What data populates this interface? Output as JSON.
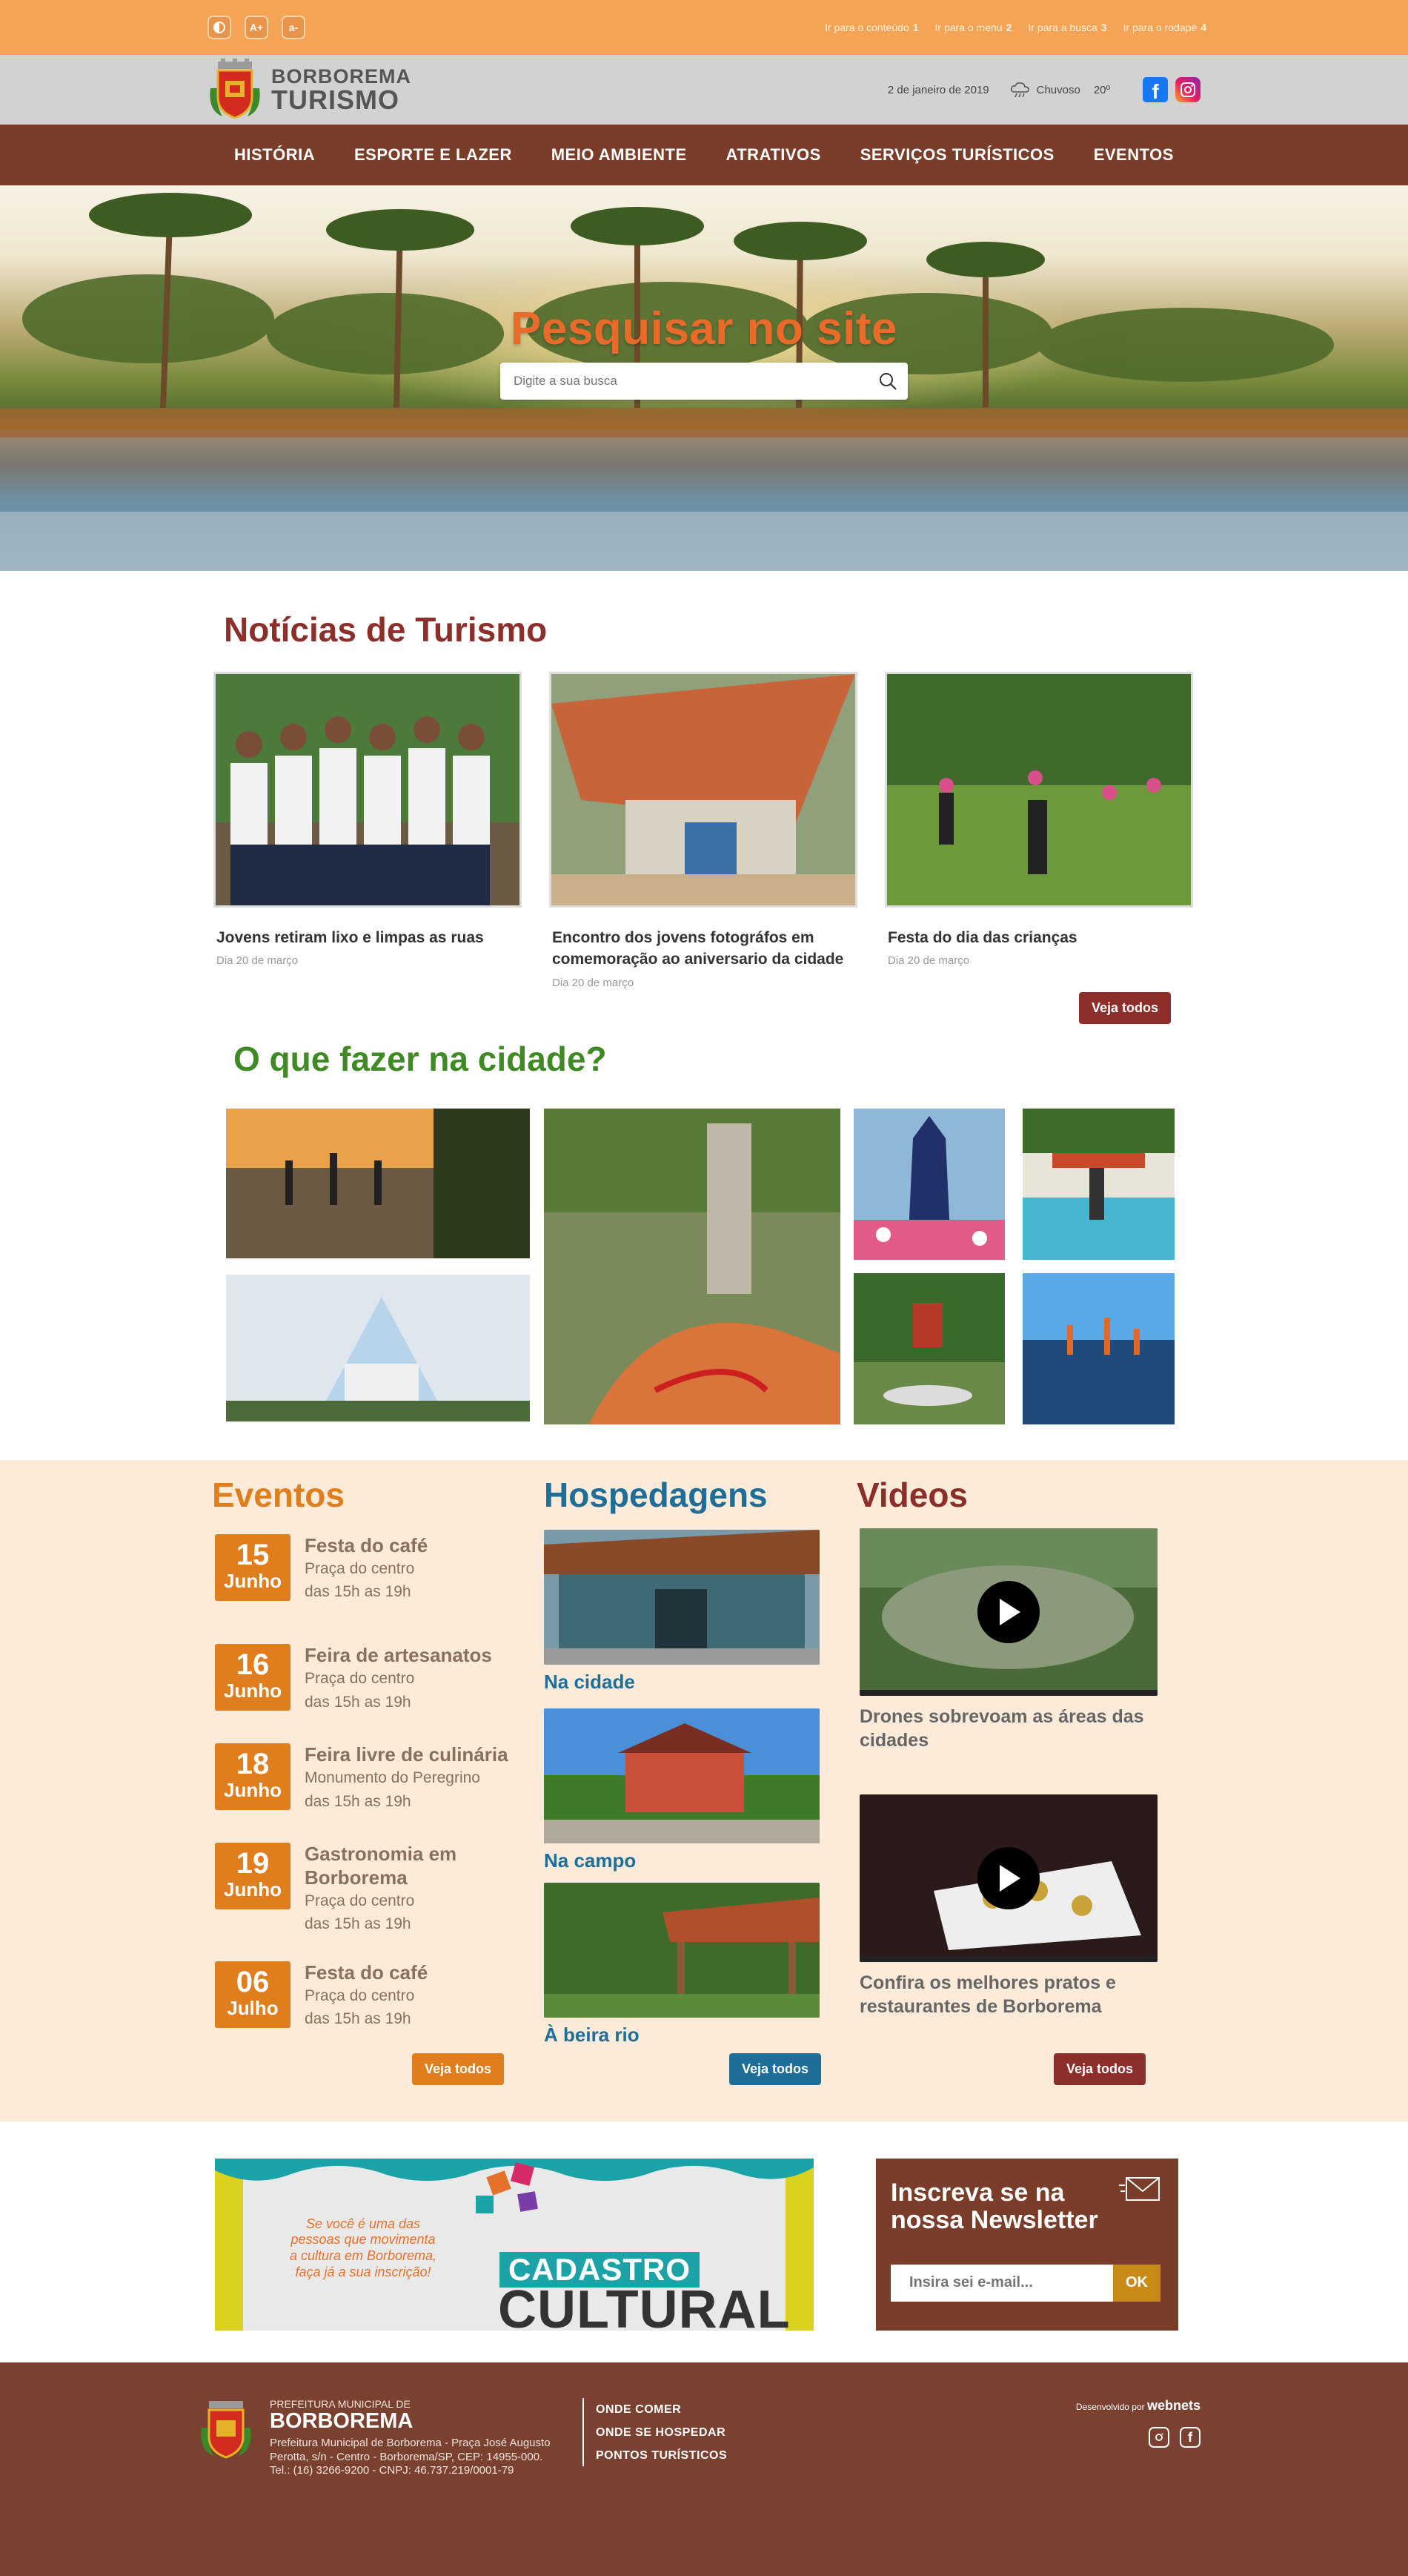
{
  "accessibility": {
    "contrast_icon": "contrast-icon",
    "font_increase_label": "A+",
    "font_decrease_label": "a-",
    "skip_links": [
      {
        "label": "Ir para o conteúdo",
        "key": "1"
      },
      {
        "label": "Ir para o menu",
        "key": "2"
      },
      {
        "label": "Ir para a busca",
        "key": "3"
      },
      {
        "label": "Ir para o rodapé",
        "key": "4"
      }
    ]
  },
  "header": {
    "logo_line1": "BORBOREMA",
    "logo_line2": "TURISMO",
    "date": "2 de janeiro de 2019",
    "weather_text": "Chuvoso",
    "temperature": "20º",
    "weather_icon": "cloud-rain-icon"
  },
  "nav": {
    "items": [
      "HISTÓRIA",
      "ESPORTE E LAZER",
      "MEIO AMBIENTE",
      "ATRATIVOS",
      "SERVIÇOS TURÍSTICOS",
      "EVENTOS"
    ]
  },
  "hero": {
    "title": "Pesquisar no site",
    "search_placeholder": "Digite a sua busca"
  },
  "news": {
    "title": "Notícias de Turismo",
    "items": [
      {
        "title": "Jovens retiram lixo e limpas as ruas",
        "date": "Dia 20 de março"
      },
      {
        "title": "Encontro dos jovens fotográfos em comemoração ao aniversario da cidade",
        "date": "Dia 20 de março"
      },
      {
        "title": "Festa do dia das crianças",
        "date": "Dia 20 de março"
      }
    ],
    "see_all": "Veja todos"
  },
  "todo": {
    "title": "O que fazer na cidade?"
  },
  "events": {
    "title": "Eventos",
    "items": [
      {
        "day": "15",
        "month": "Junho",
        "name": "Festa do café",
        "place": "Praça do centro",
        "time": "das 15h as 19h"
      },
      {
        "day": "16",
        "month": "Junho",
        "name": "Feira de artesanatos",
        "place": "Praça do centro",
        "time": "das 15h as 19h"
      },
      {
        "day": "18",
        "month": "Junho",
        "name": "Feira livre de culinária",
        "place": "Monumento do Peregrino",
        "time": "das 15h as 19h"
      },
      {
        "day": "19",
        "month": "Junho",
        "name": "Gastronomia em Borborema",
        "place": "Praça do centro",
        "time": "das 15h as 19h"
      },
      {
        "day": "06",
        "month": "Julho",
        "name": "Festa do café",
        "place": "Praça do centro",
        "time": "das 15h as 19h"
      }
    ],
    "see_all": "Veja todos"
  },
  "lodging": {
    "title": "Hospedagens",
    "items": [
      "Na cidade",
      "Na campo",
      "À beira rio"
    ],
    "see_all": "Veja todos"
  },
  "videos": {
    "title": "Videos",
    "items": [
      {
        "title": "Drones sobrevoam as áreas das cidades"
      },
      {
        "title": "Confira os melhores pratos e restaurantes de Borborema"
      }
    ],
    "see_all": "Veja todos"
  },
  "banner": {
    "text": "Se você é uma das pessoas que movimenta a cultura em Borborema, faça já a sua inscrição!",
    "tag": "CADASTRO",
    "big": "CULTURAL"
  },
  "newsletter": {
    "title": "Inscreva se na nossa Newsletter",
    "placeholder": "Insira sei e-mail...",
    "button": "OK"
  },
  "footer": {
    "small": "PREFEITURA MUNICIPAL DE",
    "big": "BORBOREMA",
    "address": "Prefeitura Municipal de Borborema - Praça José Augusto Perotta, s/n - Centro - Borborema/SP, CEP: 14955-000. Tel.: (16) 3266-9200 - CNPJ: 46.737.219/0001-79",
    "links": [
      "ONDE COMER",
      "ONDE SE HOSPEDAR",
      "PONTOS TURÍSTICOS"
    ],
    "dev_label": "Desenvolvido por",
    "dev_brand": "webnets"
  },
  "colors": {
    "topbar": "#f4a454",
    "nav": "#7a3d2a",
    "news_title": "#8c2f2a",
    "todo_title": "#3f8a25",
    "events_accent": "#e07e1e",
    "lodging_accent": "#1f6e98"
  }
}
